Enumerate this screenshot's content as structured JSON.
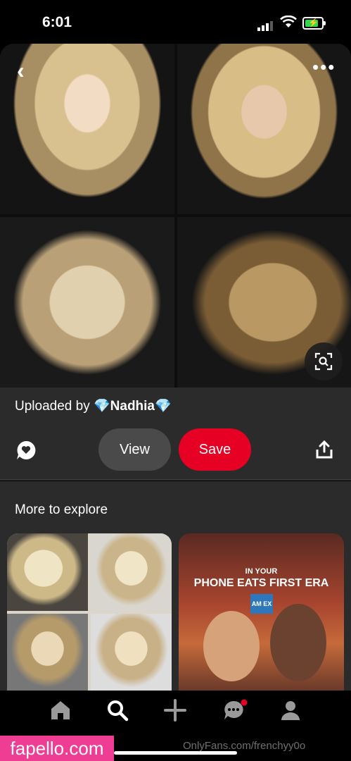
{
  "status": {
    "time": "6:01",
    "battery_color": "#32d74b"
  },
  "pin": {
    "uploaded_prefix": "Uploaded by",
    "uploader_name": "Nadhia",
    "uploader_emoji": "💎",
    "view_label": "View",
    "save_label": "Save",
    "save_color": "#e60023"
  },
  "explore": {
    "title": "More to explore",
    "ad": {
      "small_text": "IN YOUR",
      "big_text": "PHONE EATS FIRST ERA",
      "logo_text": "AM EX"
    }
  },
  "nav": {
    "items": [
      "home-icon",
      "search-icon",
      "add-icon",
      "messages-icon",
      "profile-icon"
    ],
    "notification_color": "#e60023"
  },
  "watermark": {
    "left": "fapello.com",
    "right": "OnlyFans.com/frenchyy0o"
  }
}
